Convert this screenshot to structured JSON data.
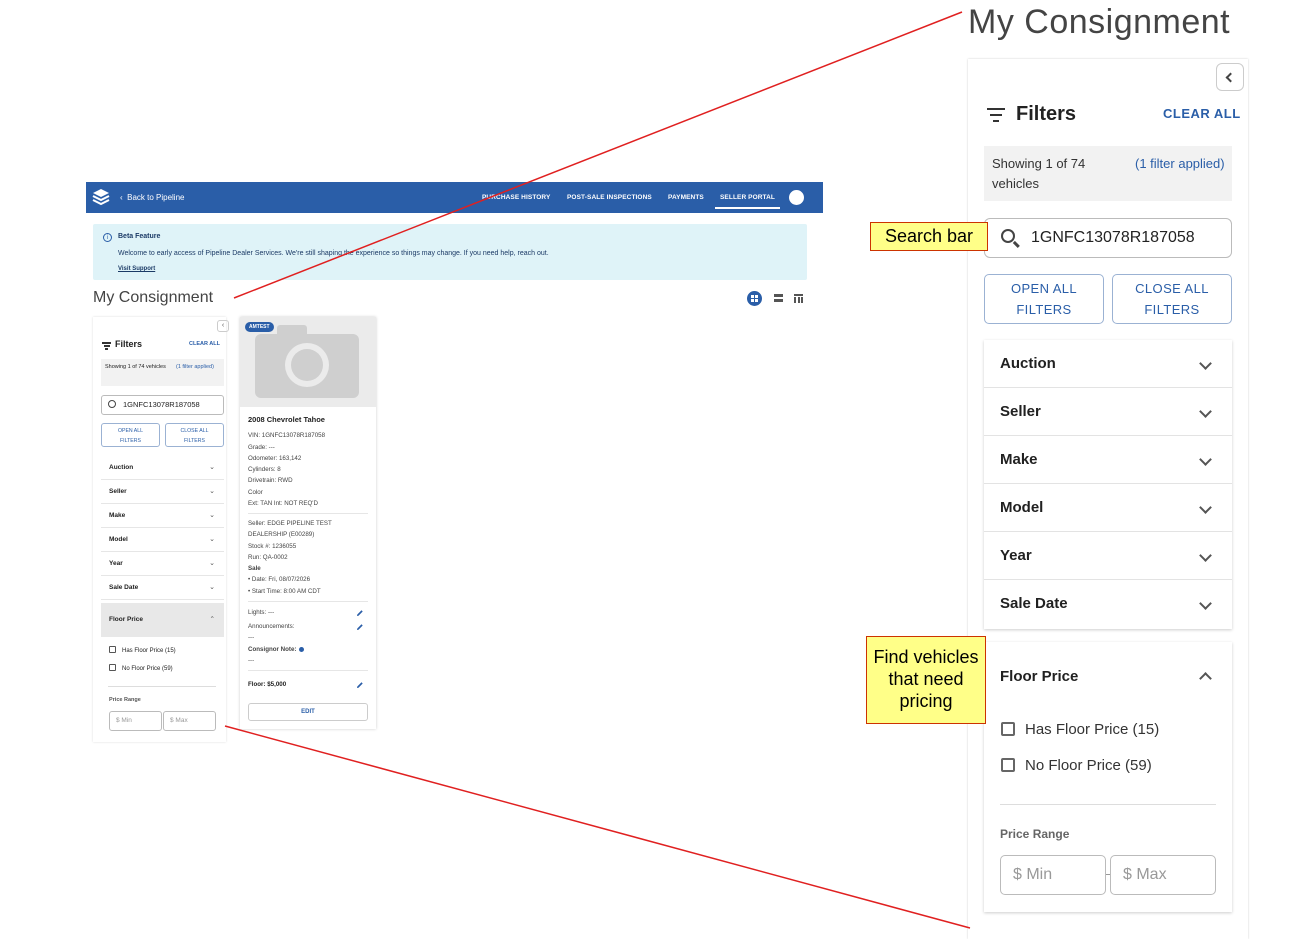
{
  "mini": {
    "nav": {
      "back_label": "Back to Pipeline",
      "items": [
        "PURCHASE HISTORY",
        "POST-SALE INSPECTIONS",
        "PAYMENTS",
        "SELLER PORTAL"
      ]
    },
    "beta": {
      "title": "Beta Feature",
      "text": "Welcome to early access of Pipeline Dealer Services. We're still shaping the experience so things may change. If you need help, reach out.",
      "link": "Visit Support"
    },
    "page_title": "My Consignment",
    "filters": {
      "title": "Filters",
      "clear_all": "CLEAR ALL",
      "showing": "Showing 1 of 74 vehicles",
      "applied": "(1 filter applied)",
      "search_value": "1GNFC13078R187058",
      "open_all_1": "OPEN ALL",
      "open_all_2": "FILTERS",
      "close_all_1": "CLOSE ALL",
      "close_all_2": "FILTERS",
      "sections": [
        "Auction",
        "Seller",
        "Make",
        "Model",
        "Year",
        "Sale Date"
      ],
      "floor_price": "Floor Price",
      "has_floor": "Has Floor Price (15)",
      "no_floor": "No Floor Price (59)",
      "price_range": "Price Range",
      "min_placeholder": "$  Min",
      "max_placeholder": "$  Max"
    },
    "card": {
      "badge": "AMTEST",
      "title": "2008 Chevrolet Tahoe",
      "vin": "VIN:  1GNFC13078R187058",
      "grade": "Grade:  ---",
      "odometer": "Odometer:  163,142",
      "cylinders": "Cylinders:  8",
      "drivetrain": "Drivetrain:  RWD",
      "color_label": "Color",
      "color": "Ext:  TAN  Int:  NOT REQ'D",
      "seller_1": "Seller:  EDGE PIPELINE TEST",
      "seller_2": "DEALERSHIP (E00289)",
      "stock": "Stock #:  1236055",
      "run": "Run:  QA-0002",
      "sale_label": "Sale",
      "sale_date": "•  Date:  Fri, 08/07/2026",
      "sale_time": "•  Start Time:  8:00 AM CDT",
      "lights": "Lights:  ---",
      "announcements": "Announcements:",
      "announcements_val": "---",
      "consignor_note": "Consignor Note:",
      "consignor_val": "---",
      "floor": "Floor:  $5,000",
      "edit": "EDIT"
    }
  },
  "zoom": {
    "page_title": "My Consignment",
    "filters_title": "Filters",
    "clear_all": "CLEAR ALL",
    "showing": "Showing 1 of 74 vehicles",
    "applied": "(1 filter applied)",
    "search_value": "1GNFC13078R187058",
    "open_all_1": "OPEN ALL",
    "open_all_2": "FILTERS",
    "close_all_1": "CLOSE ALL",
    "close_all_2": "FILTERS",
    "sections": [
      "Auction",
      "Seller",
      "Make",
      "Model",
      "Year",
      "Sale Date"
    ],
    "floor_price": "Floor Price",
    "has_floor": "Has Floor Price (15)",
    "no_floor": "No Floor Price (59)",
    "price_range": "Price Range",
    "min_placeholder": "$  Min",
    "max_placeholder": "$  Max"
  },
  "callouts": {
    "search": "Search bar",
    "find_1": "Find vehicles",
    "find_2": "that need",
    "find_3": "pricing"
  },
  "colors": {
    "brand_blue": "#2a5ea8",
    "callout_fill": "#ffff88",
    "pointer_line": "#e02020"
  }
}
